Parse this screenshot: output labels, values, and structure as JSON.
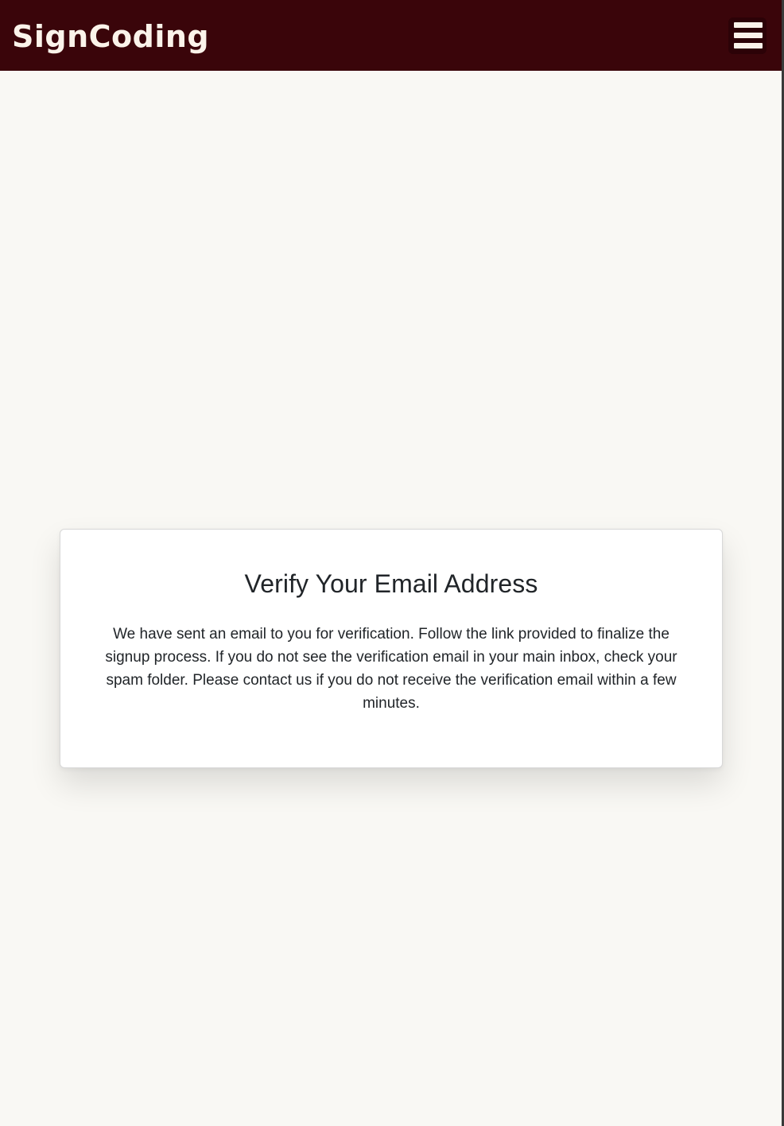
{
  "navbar": {
    "brand": "SignCoding",
    "menu_icon": "hamburger-menu-icon",
    "background_color": "#3a050a",
    "text_color": "#fbf3ea"
  },
  "verification_card": {
    "title": "Verify Your Email Address",
    "message": "We have sent an email to you for verification. Follow the link provided to finalize the signup process. If you do not see the verification email in your main inbox, check your spam folder. Please contact us if you do not receive the verification email within a few minutes."
  },
  "page": {
    "background_color": "#f9f8f4"
  }
}
